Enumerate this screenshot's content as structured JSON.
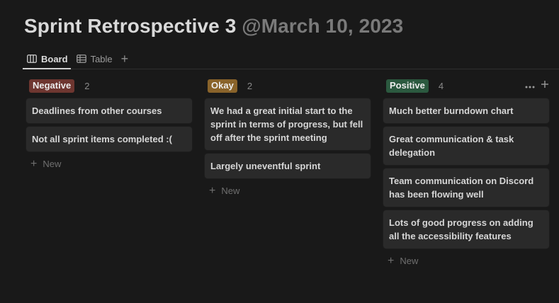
{
  "page": {
    "title": "Sprint Retrospective 3",
    "date": "@March 10, 2023"
  },
  "views": {
    "tabs": [
      {
        "label": "Board",
        "icon": "board-icon",
        "active": true
      },
      {
        "label": "Table",
        "icon": "table-icon",
        "active": false
      }
    ],
    "add_label": "+"
  },
  "board": {
    "new_label": "New",
    "columns": [
      {
        "tag": "Negative",
        "tag_color": "#6e3630",
        "count": "2",
        "cards": [
          "Deadlines from other courses",
          "Not all sprint items completed :("
        ]
      },
      {
        "tag": "Okay",
        "tag_color": "#89632a",
        "count": "2",
        "cards": [
          "We had a great initial start to the sprint in terms of progress, but fell off after the sprint meeting",
          "Largely uneventful sprint"
        ]
      },
      {
        "tag": "Positive",
        "tag_color": "#2b593f",
        "count": "4",
        "cards": [
          "Much better burndown chart",
          "Great communication & task delegation",
          "Team communication on Discord has been flowing well",
          "Lots of good progress on adding all the accessibility features"
        ]
      }
    ]
  }
}
